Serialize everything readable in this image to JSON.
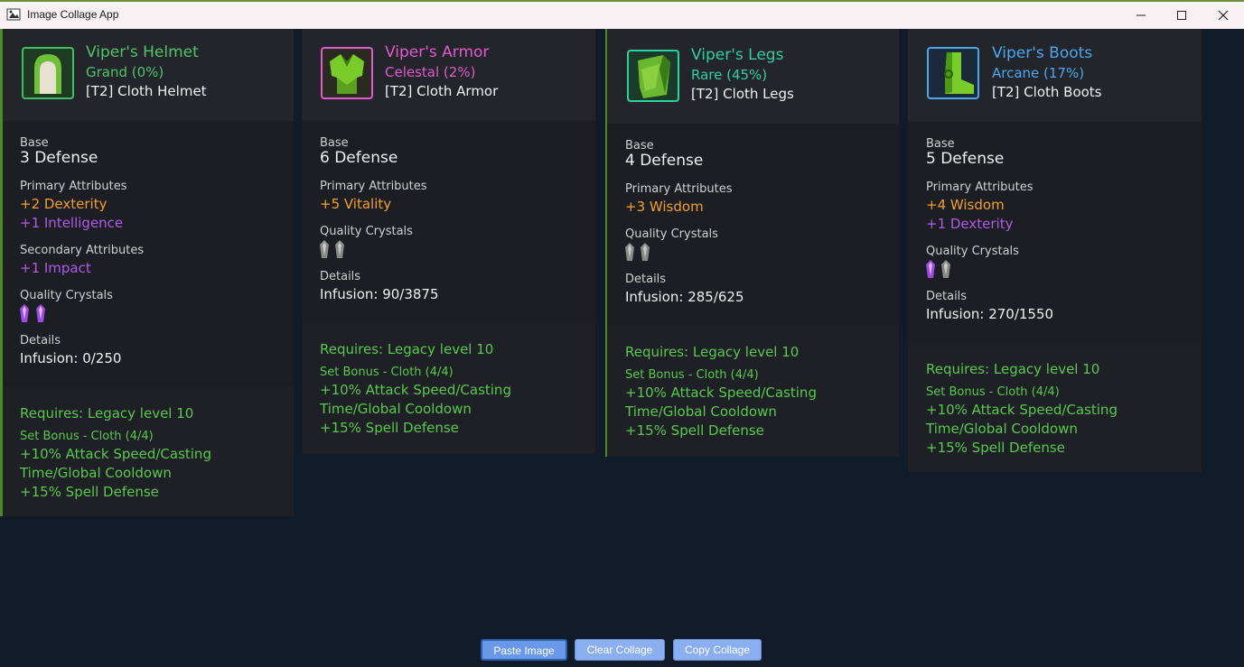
{
  "window": {
    "title": "Image Collage App"
  },
  "cards": [
    {
      "name": "Viper's Helmet",
      "rarity": "Grand (0%)",
      "type": "[T2] Cloth Helmet",
      "base_label": "Base",
      "base_value": "3 Defense",
      "primary_label": "Primary Attributes",
      "primary_1": "+2 Dexterity",
      "primary_2": "+1 Intelligence",
      "secondary_label": "Secondary Attributes",
      "secondary_1": "+1 Impact",
      "crystals_label": "Quality Crystals",
      "details_label": "Details",
      "infusion": "Infusion: 0/250",
      "requires": "Requires: Legacy level 10",
      "set_bonus": "Set Bonus - Cloth (4/4)",
      "bonus_1": "+10% Attack Speed/Casting Time/Global Cooldown",
      "bonus_2": "+15% Spell Defense"
    },
    {
      "name": "Viper's Armor",
      "rarity": "Celestal (2%)",
      "type": "[T2] Cloth Armor",
      "base_label": "Base",
      "base_value": "6 Defense",
      "primary_label": "Primary Attributes",
      "primary_1": "+5 Vitality",
      "crystals_label": "Quality Crystals",
      "details_label": "Details",
      "infusion": "Infusion: 90/3875",
      "requires": "Requires: Legacy level 10",
      "set_bonus": "Set Bonus - Cloth (4/4)",
      "bonus_1": "+10% Attack Speed/Casting Time/Global Cooldown",
      "bonus_2": "+15% Spell Defense"
    },
    {
      "name": "Viper's Legs",
      "rarity": "Rare (45%)",
      "type": "[T2] Cloth Legs",
      "base_label": "Base",
      "base_value": "4 Defense",
      "primary_label": "Primary Attributes",
      "primary_1": "+3 Wisdom",
      "crystals_label": "Quality Crystals",
      "details_label": "Details",
      "infusion": "Infusion: 285/625",
      "requires": "Requires: Legacy level 10",
      "set_bonus": "Set Bonus - Cloth (4/4)",
      "bonus_1": "+10% Attack Speed/Casting Time/Global Cooldown",
      "bonus_2": "+15% Spell Defense"
    },
    {
      "name": "Viper's Boots",
      "rarity": "Arcane (17%)",
      "type": "[T2] Cloth Boots",
      "base_label": "Base",
      "base_value": "5 Defense",
      "primary_label": "Primary Attributes",
      "primary_1": "+4 Wisdom",
      "primary_2": "+1 Dexterity",
      "crystals_label": "Quality Crystals",
      "details_label": "Details",
      "infusion": "Infusion: 270/1550",
      "requires": "Requires: Legacy level 10",
      "set_bonus": "Set Bonus - Cloth (4/4)",
      "bonus_1": "+10% Attack Speed/Casting Time/Global Cooldown",
      "bonus_2": "+15% Spell Defense"
    }
  ],
  "colors": {
    "grand": "#4fc46a",
    "celestal": "#e05ad0",
    "rare": "#2fd0a0",
    "arcane": "#4aa8f0",
    "green_text": "#58c94e",
    "primary_orange": "#f0a030",
    "purple_attr": "#b05ae8",
    "crystal_purple": "#9b4ae0",
    "crystal_gray": "#8a8a8a"
  },
  "buttons": {
    "paste": "Paste Image",
    "clear": "Clear Collage",
    "copy": "Copy Collage"
  }
}
